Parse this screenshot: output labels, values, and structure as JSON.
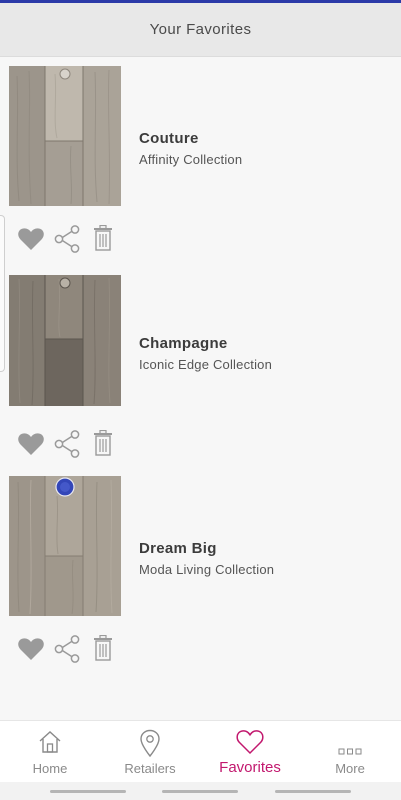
{
  "header": {
    "title": "Your Favorites"
  },
  "favorites": [
    {
      "name": "Couture",
      "collection": "Affinity Collection",
      "thumbnail": "oak-plank-light-grey"
    },
    {
      "name": "Champagne",
      "collection": "Iconic Edge Collection",
      "thumbnail": "oak-plank-dark-grey"
    },
    {
      "name": "Dream Big",
      "collection": "Moda Living Collection",
      "thumbnail": "oak-plank-taupe"
    }
  ],
  "item_actions": {
    "icons": [
      "heart-icon",
      "share-icon",
      "trash-icon"
    ]
  },
  "nav": {
    "items": [
      {
        "label": "Home",
        "icon": "home-icon"
      },
      {
        "label": "Retailers",
        "icon": "map-pin-icon"
      },
      {
        "label": "Favorites",
        "icon": "heart-outline-icon"
      },
      {
        "label": "More",
        "icon": "more-icon"
      }
    ],
    "active_index": 2
  },
  "colors": {
    "accent": "#c2186e",
    "header_bg": "#e8e8e8",
    "icon_grey": "#9a9a9a",
    "top_strip": "#2b3aa8"
  }
}
